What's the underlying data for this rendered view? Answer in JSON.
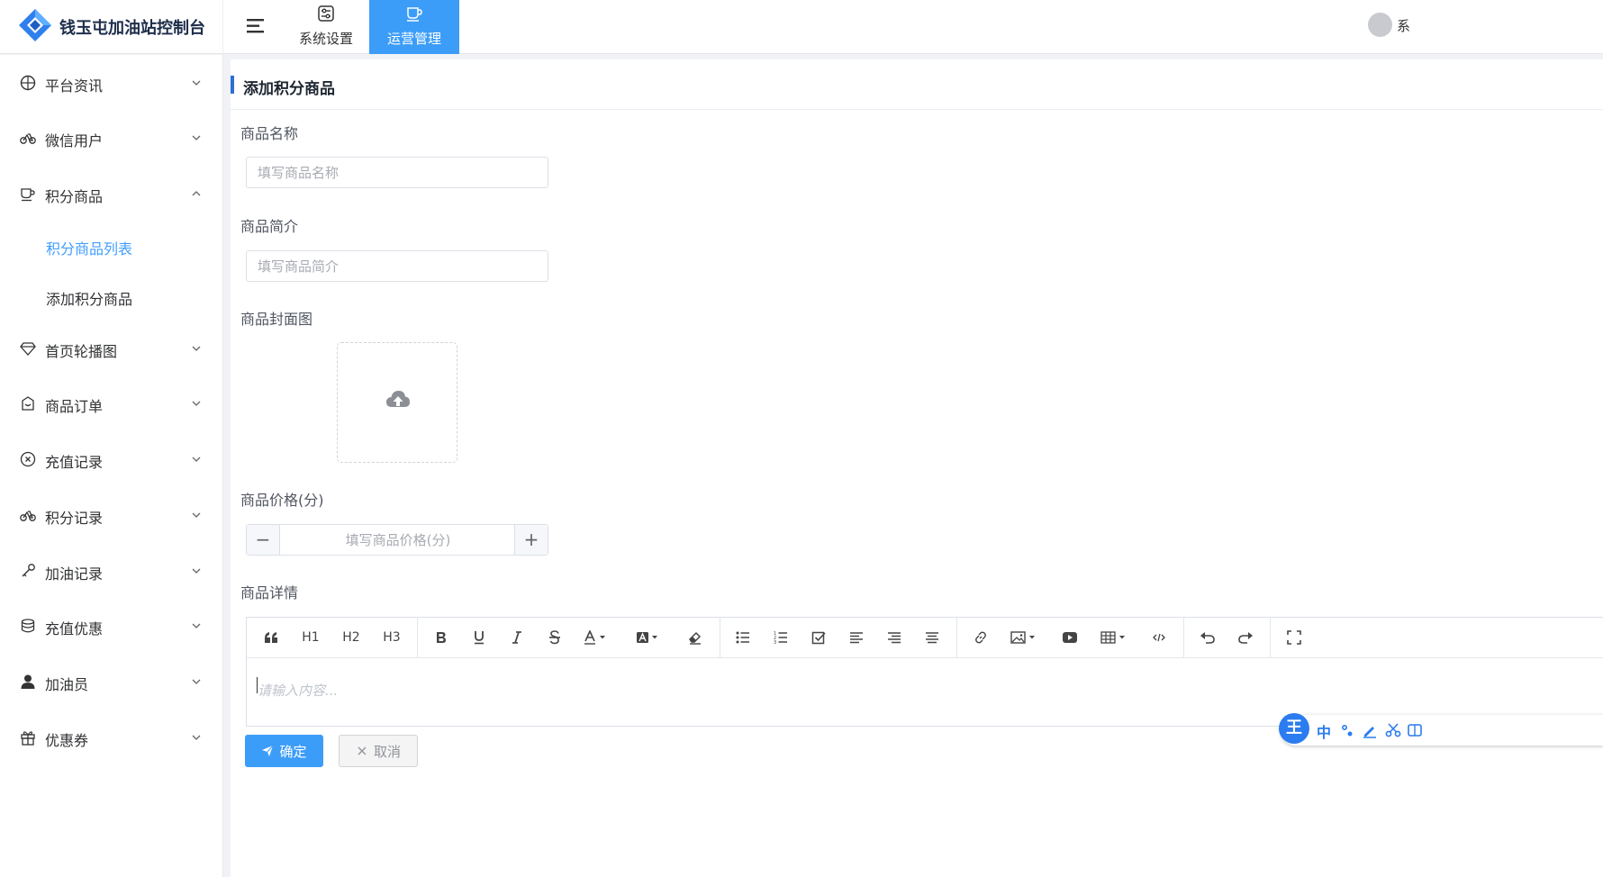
{
  "app": {
    "title": "钱玉屯加油站控制台",
    "accent": "#3c9df8",
    "logo_color": "#2f80ed"
  },
  "topnav": {
    "tabs": [
      {
        "label": "系统设置",
        "icon": "sliders-icon"
      },
      {
        "label": "运营管理",
        "icon": "coffee-cup-icon",
        "active": true
      }
    ],
    "user_label": "系"
  },
  "sidebar": {
    "items": [
      {
        "label": "平台资讯",
        "icon": "compass-icon",
        "expanded": false
      },
      {
        "label": "微信用户",
        "icon": "bicycle-icon",
        "expanded": false
      },
      {
        "label": "积分商品",
        "icon": "coffee-cup-icon",
        "expanded": true,
        "children": [
          {
            "label": "积分商品列表",
            "active": true
          },
          {
            "label": "添加积分商品",
            "active": false
          }
        ]
      },
      {
        "label": "首页轮播图",
        "icon": "diamond-icon",
        "expanded": false
      },
      {
        "label": "商品订单",
        "icon": "shop-icon",
        "expanded": false
      },
      {
        "label": "充值记录",
        "icon": "circle-close-icon",
        "expanded": false
      },
      {
        "label": "积分记录",
        "icon": "bicycle-icon",
        "expanded": false
      },
      {
        "label": "加油记录",
        "icon": "key-icon",
        "expanded": false
      },
      {
        "label": "充值优惠",
        "icon": "coin-icon",
        "expanded": false
      },
      {
        "label": "加油员",
        "icon": "user-icon",
        "expanded": false
      },
      {
        "label": "优惠券",
        "icon": "gift-icon",
        "expanded": false
      }
    ]
  },
  "page": {
    "title": "添加积分商品"
  },
  "form": {
    "name": {
      "label": "商品名称",
      "placeholder": "填写商品名称",
      "value": ""
    },
    "intro": {
      "label": "商品简介",
      "placeholder": "填写商品简介",
      "value": ""
    },
    "cover": {
      "label": "商品封面图",
      "icon": "upload-cloud-icon"
    },
    "price": {
      "label": "商品价格(分)",
      "placeholder": "填写商品价格(分)",
      "minus": "−",
      "plus": "+"
    },
    "detail": {
      "label": "商品详情",
      "placeholder": "请输入内容...",
      "toolbar": {
        "h1": "H1",
        "h2": "H2",
        "h3": "H3"
      }
    }
  },
  "actions": {
    "confirm": "确定",
    "cancel": "取消"
  },
  "ime": {
    "logo": "王",
    "mode": "中"
  }
}
